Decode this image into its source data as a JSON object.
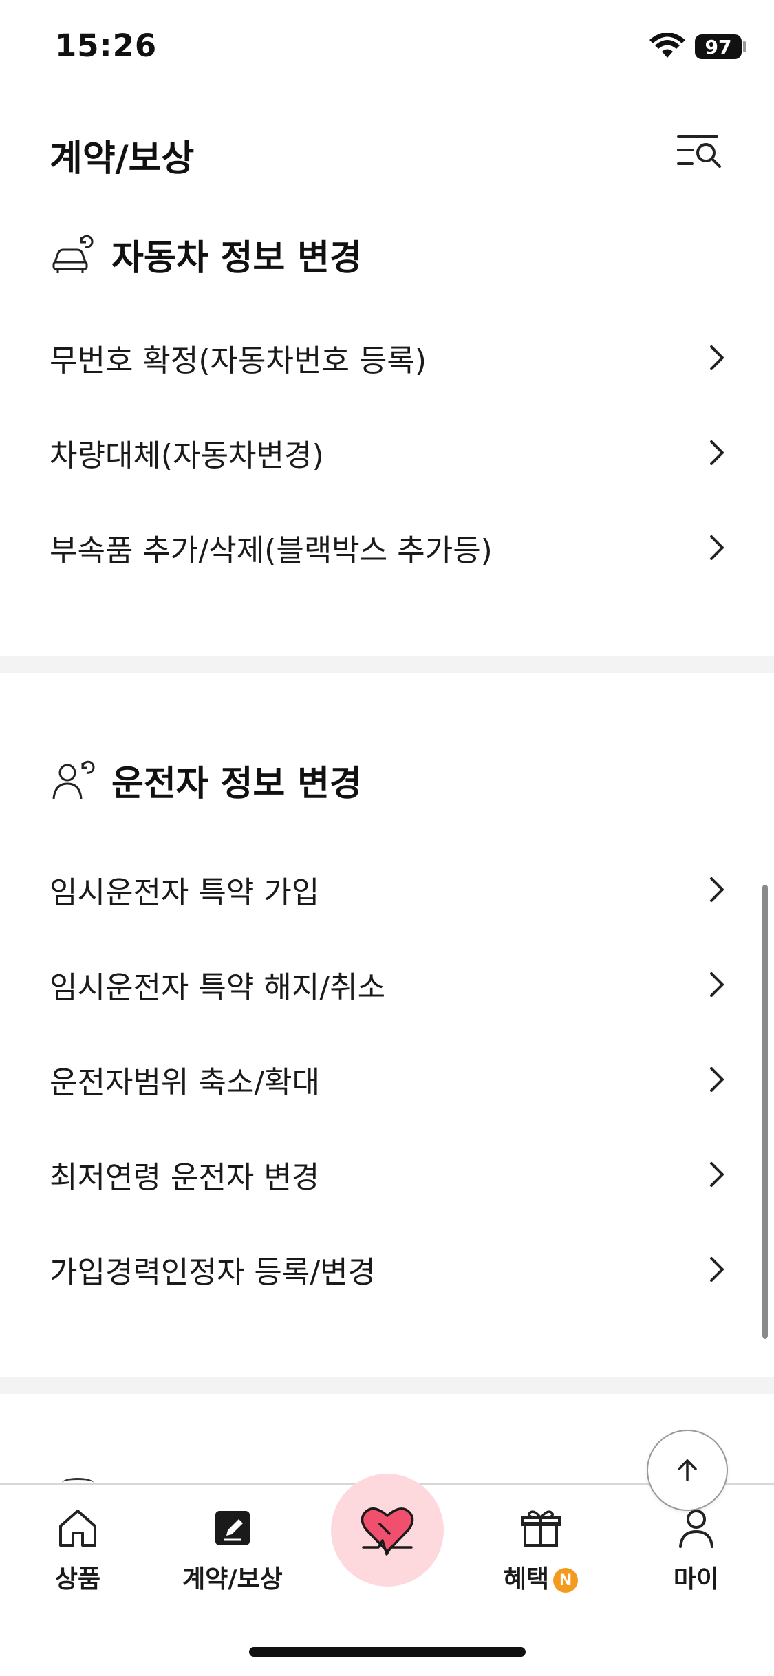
{
  "status_bar": {
    "time": "15:26",
    "battery": "97"
  },
  "header": {
    "title": "계약/보상",
    "menu_icon": "menu-search-icon"
  },
  "sections": [
    {
      "title": "자동차 정보 변경",
      "icon": "car-refresh-icon",
      "items": [
        {
          "label": "무번호 확정(자동차번호 등록)"
        },
        {
          "label": "차량대체(자동차변경)"
        },
        {
          "label": "부속품 추가/삭제(블랙박스 추가등)"
        }
      ]
    },
    {
      "title": "운전자 정보 변경",
      "icon": "driver-refresh-icon",
      "items": [
        {
          "label": "임시운전자 특약 가입"
        },
        {
          "label": "임시운전자 특약 해지/취소"
        },
        {
          "label": "운전자범위 축소/확대"
        },
        {
          "label": "최저연령 운전자 변경"
        },
        {
          "label": "가입경력인정자 등록/변경"
        }
      ]
    }
  ],
  "bottom_nav": {
    "items": [
      {
        "label": "상품",
        "icon": "home-icon"
      },
      {
        "label": "계약/보상",
        "icon": "edit-icon"
      },
      {
        "label": "",
        "icon": "heart-pulse-icon"
      },
      {
        "label": "혜택",
        "icon": "gift-icon",
        "badge": "N"
      },
      {
        "label": "마이",
        "icon": "person-icon"
      }
    ]
  },
  "colors": {
    "accent_pink": "#fdd9de",
    "heart": "#f0506e",
    "badge": "#f39a1f"
  }
}
